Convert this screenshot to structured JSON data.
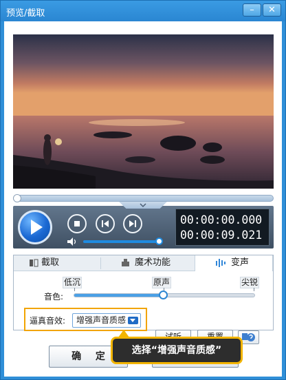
{
  "window": {
    "title": "预览/截取",
    "minimize_label": "–",
    "close_label": "✕"
  },
  "player": {
    "current_time": "00:00:00.000",
    "total_time": "00:00:09.021",
    "progress_fraction": 0.0,
    "volume_fraction": 1.0,
    "icons": [
      "play-icon",
      "stop-icon",
      "previous-frame-icon",
      "next-frame-icon",
      "volume-icon",
      "expand-chevron-icon"
    ]
  },
  "tabs": [
    {
      "label": "截取",
      "icon": "crop-icon"
    },
    {
      "label": "魔术功能",
      "icon": "magic-icon"
    },
    {
      "label": "变声",
      "icon": "voice-wave-icon",
      "active": true
    }
  ],
  "voice": {
    "pitch_label": "音色:",
    "low_label": "低沉",
    "mid_label": "原声",
    "high_label": "尖锐",
    "pitch_fraction": 0.5,
    "realistic_label": "逼真音效:",
    "realistic_value": "增强声音质感",
    "listen_button": "试听",
    "reset_button": "重置",
    "help_icon": "help-icon"
  },
  "footer": {
    "ok_button": "确 定",
    "tooltip": "选择“增强声音质感”"
  },
  "colors": {
    "title_bar": "#2a86d2",
    "accent": "#1f8be0",
    "highlight": "#f2a400"
  }
}
